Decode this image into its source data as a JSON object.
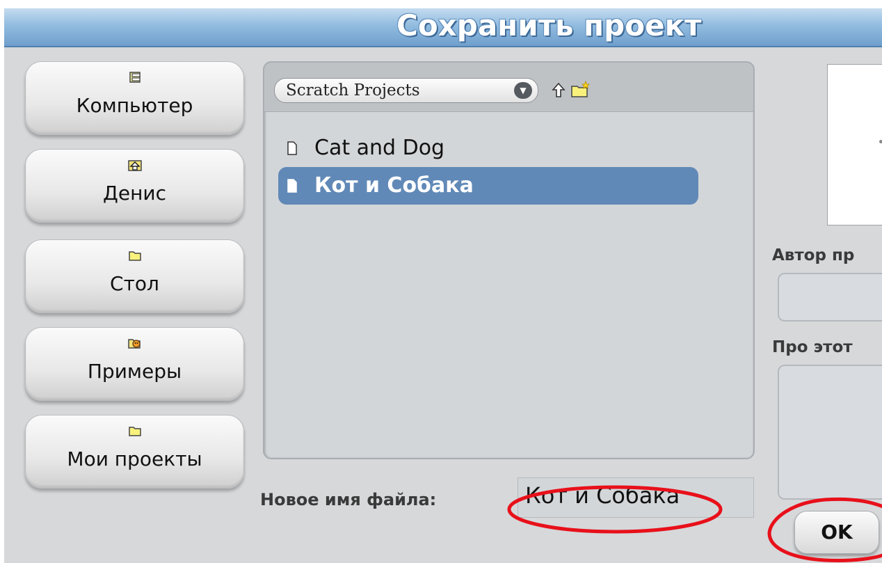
{
  "dialog": {
    "title": "Сохранить проект"
  },
  "locations": [
    {
      "label": "Компьютер",
      "icon": "computer-icon"
    },
    {
      "label": "Денис",
      "icon": "home-icon"
    },
    {
      "label": "Стол",
      "icon": "folder-icon"
    },
    {
      "label": "Примеры",
      "icon": "scratch-cat-icon"
    },
    {
      "label": "Мои проекты",
      "icon": "folder-icon"
    }
  ],
  "browser": {
    "current_folder": "Scratch Projects",
    "files": [
      {
        "name": "Cat and Dog",
        "selected": false
      },
      {
        "name": "Кот и Собака",
        "selected": true
      }
    ]
  },
  "filename": {
    "label": "Новое имя файла:",
    "value": "Кот и Собака"
  },
  "project_info": {
    "author_label": "Автор пр",
    "about_label": "Про этот"
  },
  "buttons": {
    "ok": "OK"
  },
  "colors": {
    "title_bar": "#8fb9df",
    "selection": "#6189b7",
    "annotation": "#e8101a"
  }
}
